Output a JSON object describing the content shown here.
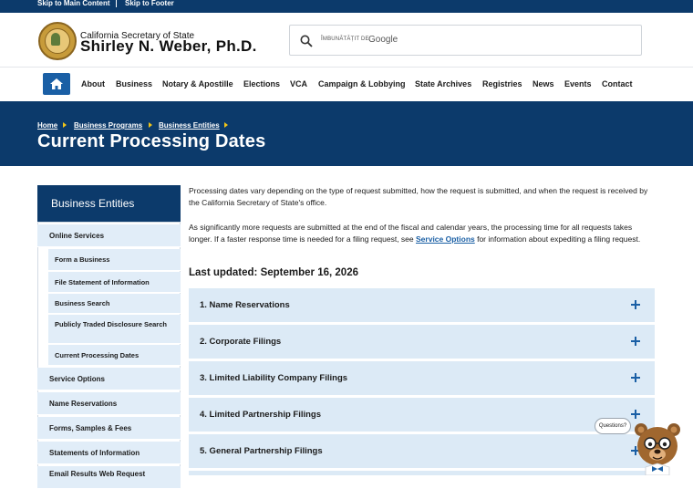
{
  "skip_links": {
    "main": "Skip to Main Content",
    "footer": "Skip to Footer"
  },
  "header": {
    "org_line": "California Secretary of State",
    "official_name": "Shirley N. Weber, Ph.D."
  },
  "search": {
    "prefix": "ÎMBUNĂTĂȚIT DE",
    "brand": "Google"
  },
  "nav": {
    "items": [
      "About",
      "Business",
      "Notary & Apostille",
      "Elections",
      "VCA",
      "Campaign & Lobbying",
      "State Archives",
      "Registries",
      "News",
      "Events",
      "Contact"
    ]
  },
  "breadcrumb": [
    "Home",
    "Business Programs",
    "Business Entities"
  ],
  "page_title": "Current Processing Dates",
  "sidebar": {
    "heading": "Business Entities",
    "online_services": "Online Services",
    "sub_items": [
      "Form a Business",
      "File Statement of Information",
      "Business Search",
      "Publicly Traded Disclosure Search",
      "Current Processing Dates"
    ],
    "items": [
      "Service Options",
      "Name Reservations",
      "Forms, Samples & Fees",
      "Statements of Information",
      "Email Results Web Request"
    ]
  },
  "content": {
    "para1": "Processing dates vary depending on the type of request submitted, how the request is submitted, and when the request is received by the California Secretary of State's office.",
    "para2_before": "As significantly more requests are submitted at the end of the fiscal and calendar years, the processing time for all requests takes longer. If a faster response time is needed for a filing request, see ",
    "para2_link": "Service Options",
    "para2_after": " for information about expediting a filing request.",
    "last_updated": "Last updated: September 16, 2026"
  },
  "accordion": [
    "1. Name Reservations",
    "2. Corporate Filings",
    "3. Limited Liability Company Filings",
    "4. Limited Partnership Filings",
    "5. General Partnership Filings"
  ],
  "chat": {
    "bubble": "Questions?"
  },
  "colors": {
    "primary_navy": "#0c3a6b",
    "accent_blue": "#1a5fa5",
    "panel_light": "#dceaf6",
    "breadcrumb_arrow": "#f0c419"
  }
}
